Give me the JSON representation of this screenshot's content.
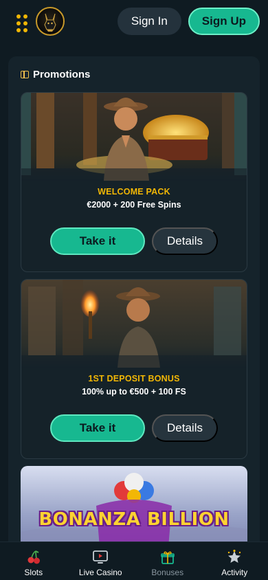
{
  "header": {
    "menu_icon": "grid-dots-icon",
    "logo_icon": "anubis-logo-icon",
    "sign_in_label": "Sign In",
    "sign_up_label": "Sign Up"
  },
  "promotions": {
    "title": "Promotions",
    "title_icon": "gift-icon",
    "cards": [
      {
        "label": "WELCOME PACK",
        "description": "€2000 + 200 Free Spins",
        "take_label": "Take it",
        "details_label": "Details"
      },
      {
        "label": "1ST DEPOSIT BONUS",
        "description": "100% up to €500 + 100 FS",
        "take_label": "Take it",
        "details_label": "Details"
      }
    ],
    "third_card_title": "BONANZA BILLION"
  },
  "bottom_nav": {
    "items": [
      {
        "label": "Slots",
        "icon": "cherries-icon"
      },
      {
        "label": "Live Casino",
        "icon": "tv-play-icon"
      },
      {
        "label": "Bonuses",
        "icon": "gift-box-icon",
        "active": true
      },
      {
        "label": "Activity",
        "icon": "star-icon"
      }
    ]
  },
  "colors": {
    "background": "#0f1b22",
    "accent_green": "#17b890",
    "accent_gold": "#f2b705",
    "panel": "#15232b"
  }
}
